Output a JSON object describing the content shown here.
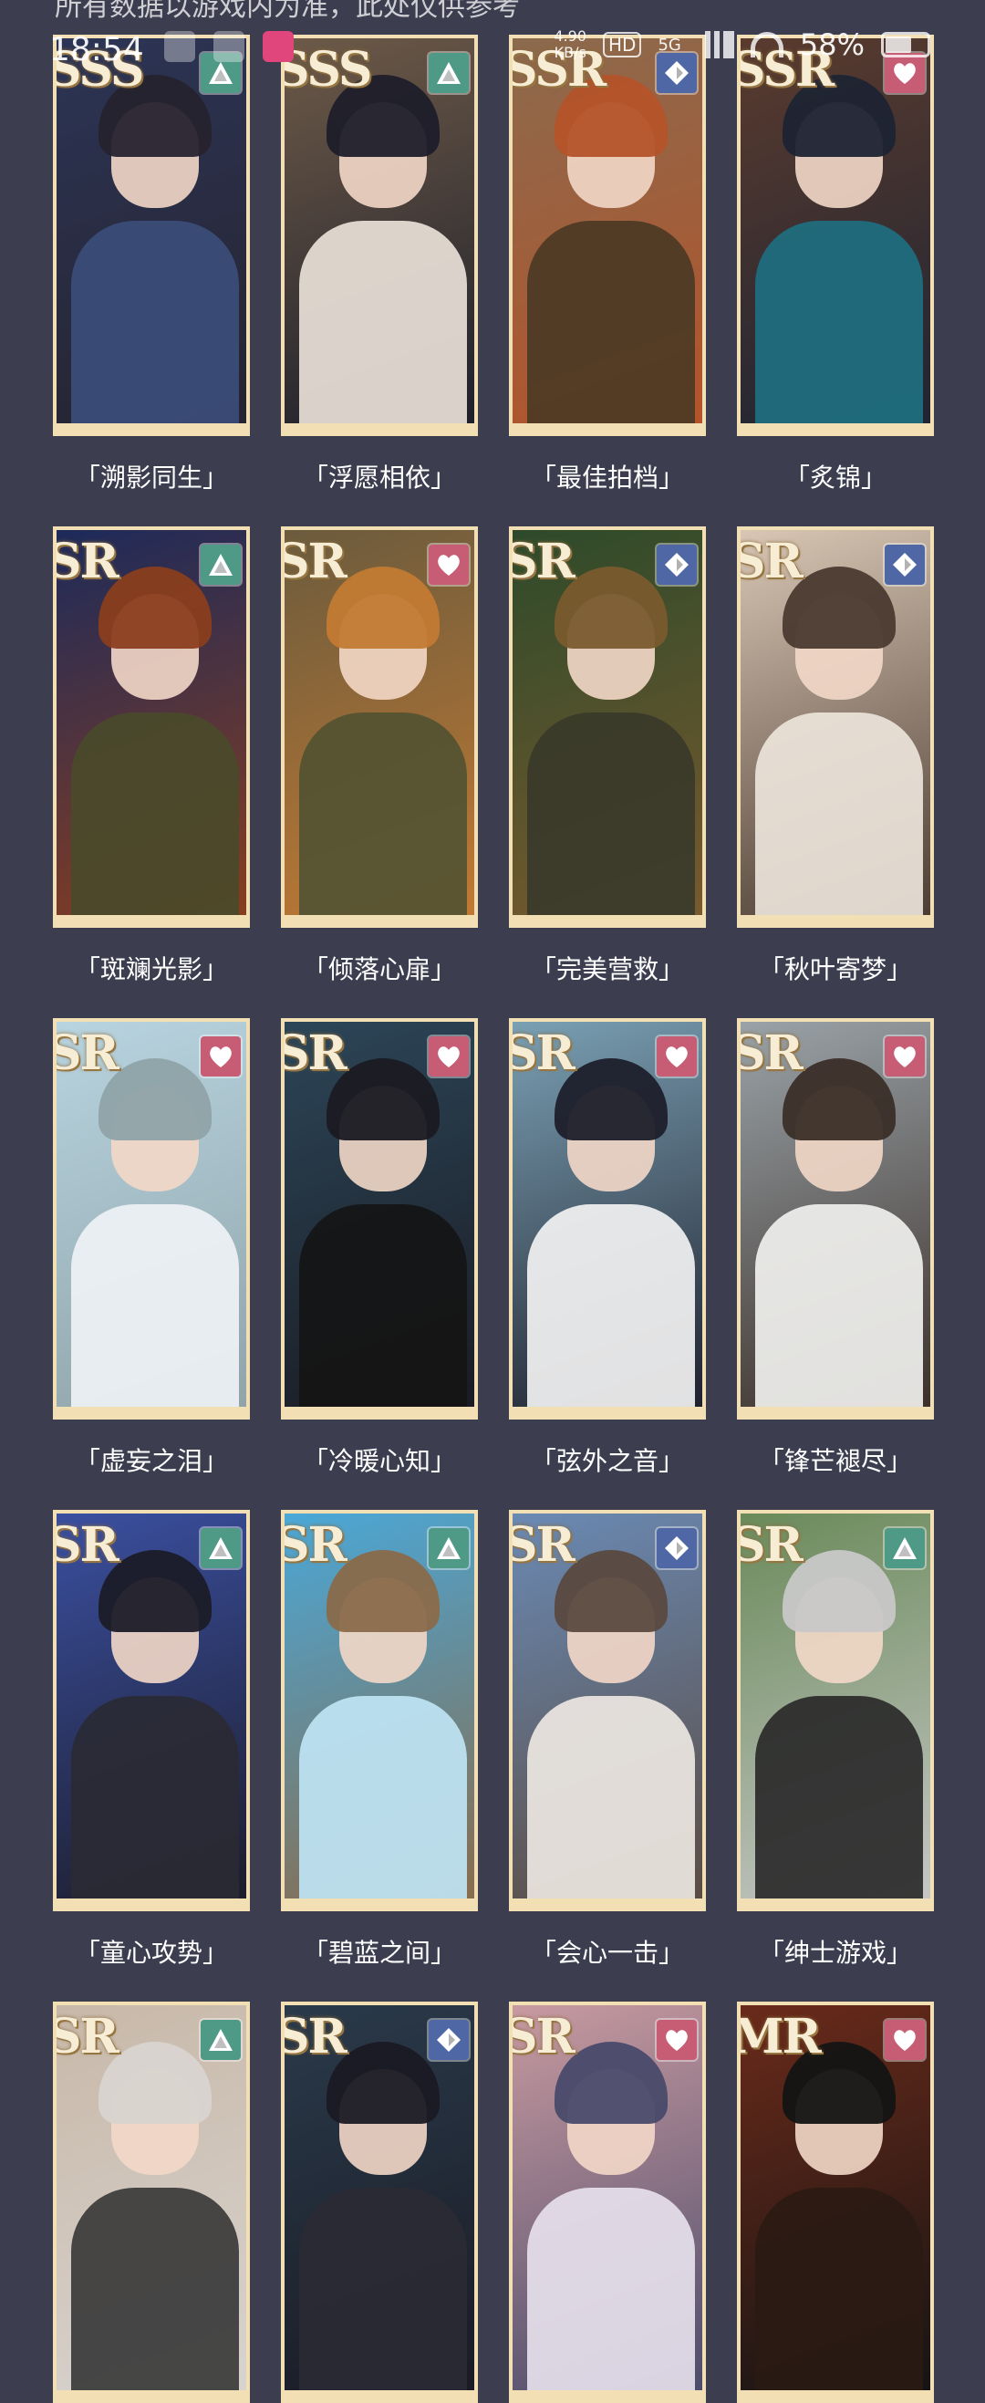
{
  "status_bar": {
    "banner_text": "所有数据以游戏内为准，此处仅供参考",
    "time": "18:54",
    "net_speed": "4.90",
    "net_unit": "KB/s",
    "hd": "HD",
    "network": "5G",
    "battery": "58%"
  },
  "colors": {
    "triangle": "#4f9a86",
    "heart": "#c65d75",
    "diamond": "#4f68a5",
    "frame": "#f2dfb4",
    "background": "#3c3d4f"
  },
  "cards": [
    {
      "rarity": "SSS",
      "type": "triangle",
      "name": "「溯影同生」"
    },
    {
      "rarity": "SSS",
      "type": "triangle",
      "name": "「浮愿相依」"
    },
    {
      "rarity": "SSR",
      "type": "diamond",
      "name": "「最佳拍档」"
    },
    {
      "rarity": "SSR",
      "type": "heart",
      "name": "「炙锦」"
    },
    {
      "rarity": "SR",
      "type": "triangle",
      "name": "「斑斓光影」"
    },
    {
      "rarity": "SR",
      "type": "heart",
      "name": "「倾落心扉」"
    },
    {
      "rarity": "SR",
      "type": "diamond",
      "name": "「完美营救」"
    },
    {
      "rarity": "SR",
      "type": "diamond",
      "name": "「秋叶寄梦」"
    },
    {
      "rarity": "SR",
      "type": "heart",
      "name": "「虚妄之泪」"
    },
    {
      "rarity": "SR",
      "type": "heart",
      "name": "「冷暖心知」"
    },
    {
      "rarity": "SR",
      "type": "heart",
      "name": "「弦外之音」"
    },
    {
      "rarity": "SR",
      "type": "heart",
      "name": "「锋芒褪尽」"
    },
    {
      "rarity": "SR",
      "type": "triangle",
      "name": "「童心攻势」"
    },
    {
      "rarity": "SR",
      "type": "triangle",
      "name": "「碧蓝之间」"
    },
    {
      "rarity": "SR",
      "type": "diamond",
      "name": "「会心一击」"
    },
    {
      "rarity": "SR",
      "type": "triangle",
      "name": "「绅士游戏」"
    },
    {
      "rarity": "SR",
      "type": "triangle",
      "name": ""
    },
    {
      "rarity": "SR",
      "type": "diamond",
      "name": ""
    },
    {
      "rarity": "SR",
      "type": "heart",
      "name": ""
    },
    {
      "rarity": "MR",
      "type": "heart",
      "name": ""
    }
  ]
}
